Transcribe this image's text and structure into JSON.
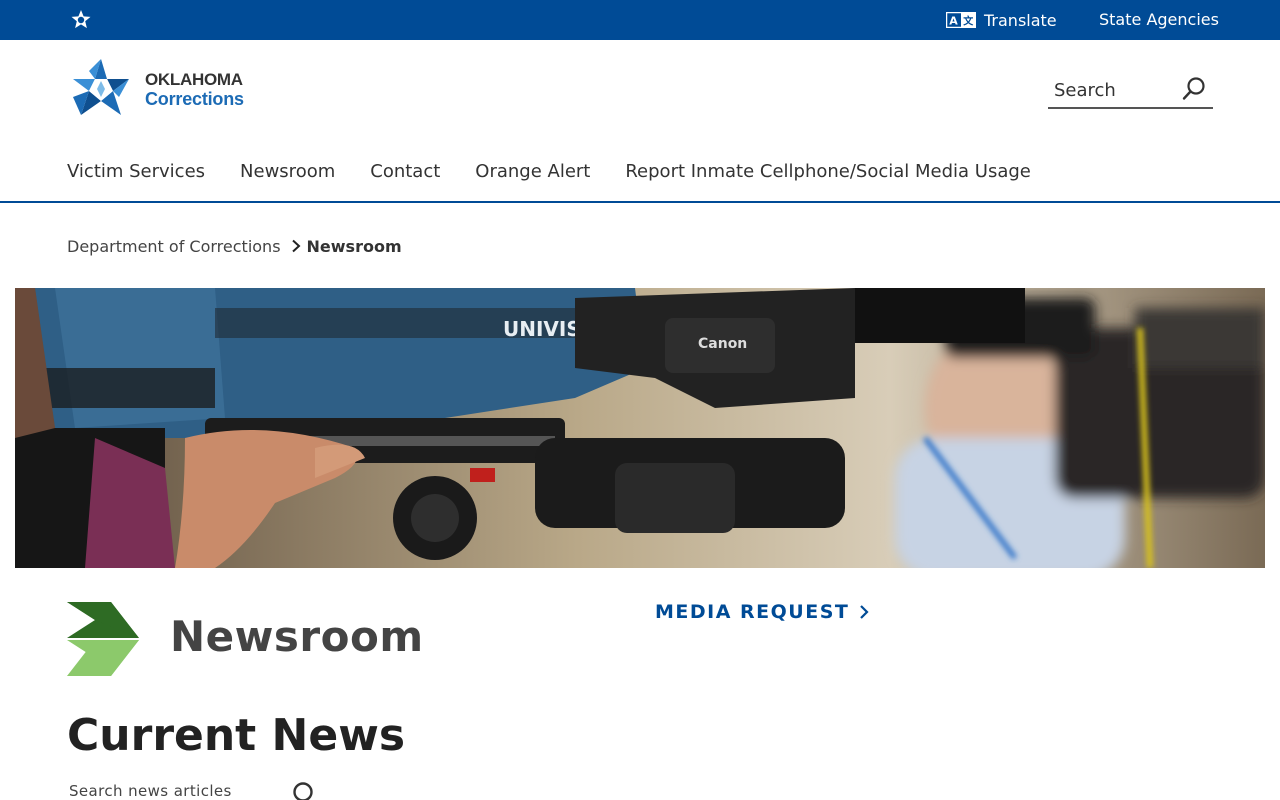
{
  "topbar": {
    "translate_label": "Translate",
    "state_agencies_label": "State Agencies",
    "icons": [
      "ok-star-icon",
      "translate-icon"
    ],
    "background_color": "#004b96"
  },
  "header": {
    "logo": {
      "line1": "OKLAHOMA",
      "line2": "Corrections"
    },
    "search_placeholder": "Search"
  },
  "nav": {
    "items": [
      {
        "label": "Victim Services"
      },
      {
        "label": "Newsroom"
      },
      {
        "label": "Contact"
      },
      {
        "label": "Orange Alert"
      },
      {
        "label": "Report Inmate Cellphone/Social Media Usage"
      }
    ]
  },
  "breadcrumb": {
    "parent": "Department of Corrections",
    "current": "Newsroom"
  },
  "hero": {
    "image_subject": "news camera crews"
  },
  "page": {
    "title": "Newsroom",
    "media_request_label": "MEDIA REQUEST",
    "section_title": "Current News",
    "news_search_placeholder": "Search news articles"
  },
  "colors": {
    "brand_blue": "#004b96",
    "chevron_dark_green": "#2e6b24",
    "chevron_light_green": "#8cc96b"
  }
}
